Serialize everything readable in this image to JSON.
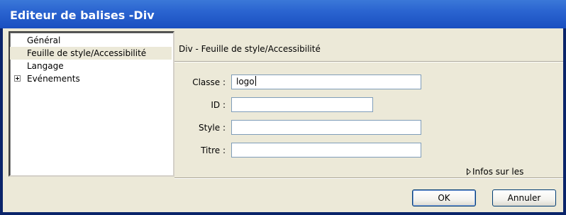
{
  "window": {
    "title": "Editeur de balises -Div"
  },
  "categories": [
    {
      "label": "Général",
      "selected": false,
      "expandable": false
    },
    {
      "label": "Feuille de style/Accessibilité",
      "selected": true,
      "expandable": false
    },
    {
      "label": "Langage",
      "selected": false,
      "expandable": false
    },
    {
      "label": "Evénements",
      "selected": false,
      "expandable": true
    }
  ],
  "section": {
    "title": "Div - Feuille de style/Accessibilité"
  },
  "form": {
    "classe": {
      "label": "Classe :",
      "value": "logo"
    },
    "id": {
      "label": "ID :",
      "value": ""
    },
    "style": {
      "label": "Style :",
      "value": ""
    },
    "titre": {
      "label": "Titre :",
      "value": ""
    }
  },
  "info_toggle": {
    "label": "Infos sur les"
  },
  "buttons": {
    "ok": "OK",
    "cancel": "Annuler"
  },
  "icons": {
    "expand": "plus-box-icon",
    "disclosure": "triangle-right-icon"
  }
}
